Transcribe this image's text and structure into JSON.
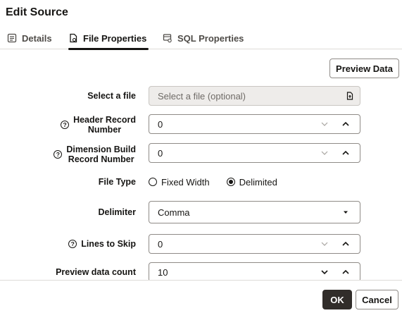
{
  "dialog": {
    "title": "Edit Source"
  },
  "tabs": [
    {
      "label": "Details",
      "icon": "details-icon",
      "active": false
    },
    {
      "label": "File Properties",
      "icon": "file-properties-icon",
      "active": true
    },
    {
      "label": "SQL Properties",
      "icon": "sql-properties-icon",
      "active": false
    }
  ],
  "toolbar": {
    "preview_label": "Preview Data"
  },
  "form": {
    "select_file": {
      "label": "Select a file",
      "placeholder": "Select a file (optional)",
      "icon": "file-upload-icon"
    },
    "header_record": {
      "label_line1": "Header Record",
      "label_line2": "Number",
      "value": "0"
    },
    "dimension_build": {
      "label_line1": "Dimension Build",
      "label_line2": "Record Number",
      "value": "0"
    },
    "file_type": {
      "label": "File Type",
      "options": [
        "Fixed Width",
        "Delimited"
      ],
      "selected": "Delimited"
    },
    "delimiter": {
      "label": "Delimiter",
      "value": "Comma"
    },
    "lines_to_skip": {
      "label": "Lines to Skip",
      "value": "0"
    },
    "preview_count": {
      "label": "Preview data count",
      "value": "10"
    }
  },
  "footer": {
    "ok_label": "OK",
    "cancel_label": "Cancel"
  },
  "colors": {
    "primary_button": "#312d2a",
    "border": "#8f8b87",
    "readonly_bg": "#eeecea"
  }
}
